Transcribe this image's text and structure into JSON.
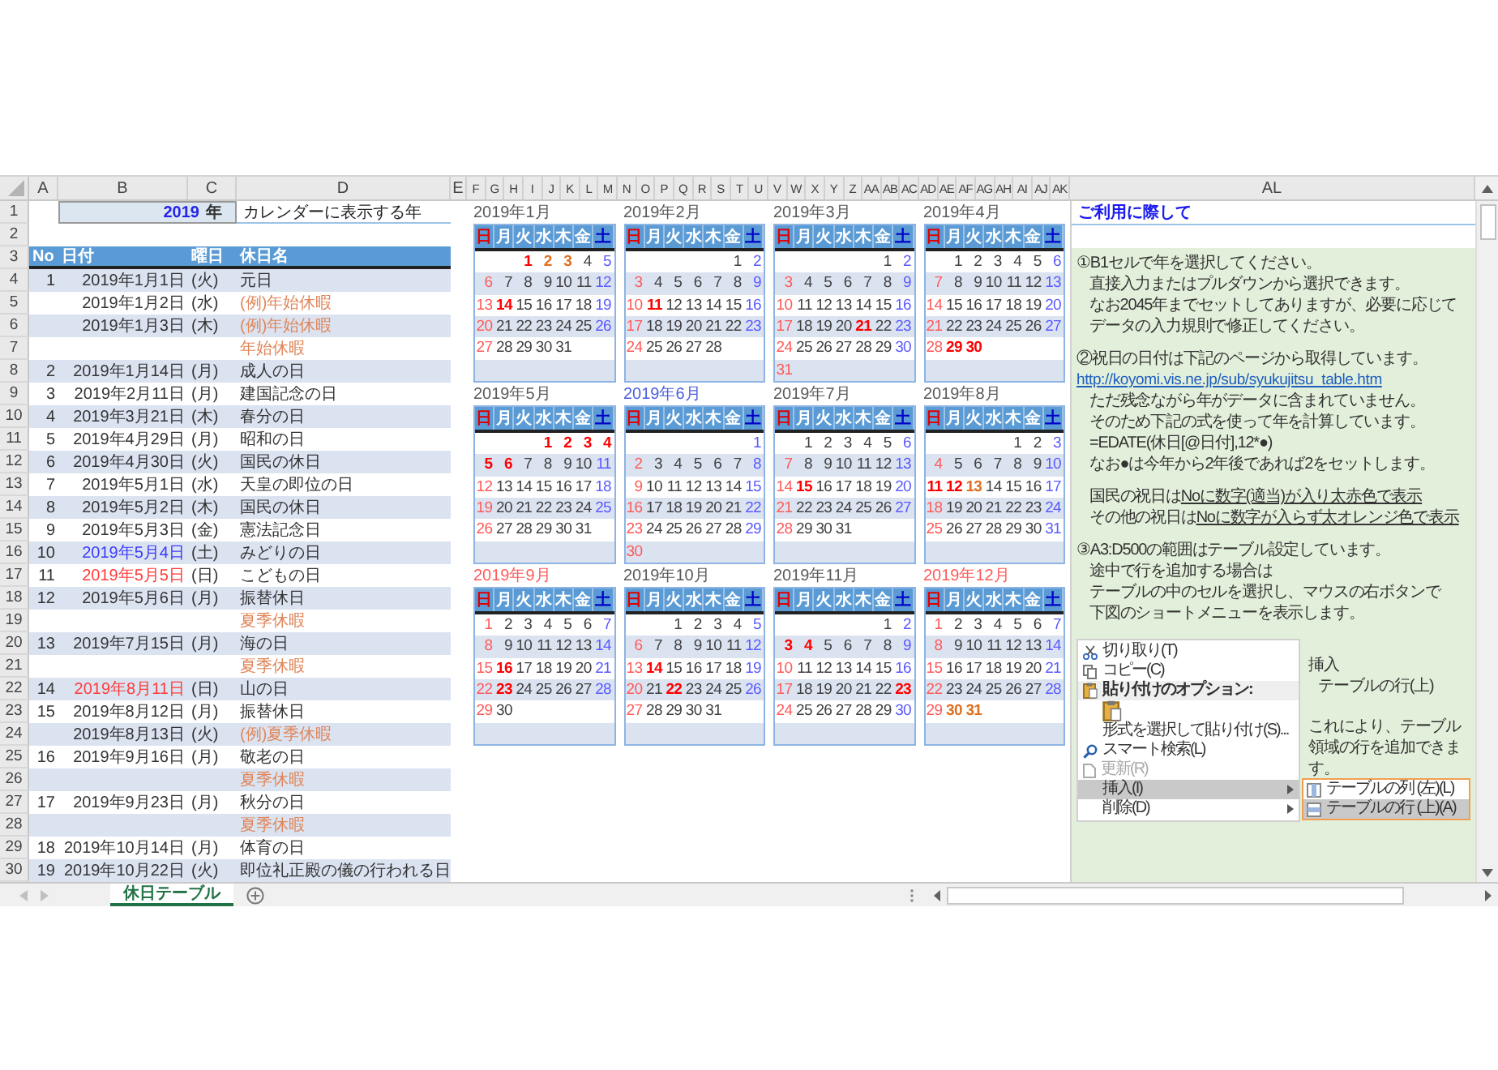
{
  "left_columns": [
    "A",
    "B",
    "C",
    "D",
    "E"
  ],
  "calendar_columns": [
    "F",
    "G",
    "H",
    "I",
    "J",
    "K",
    "L",
    "M",
    "N",
    "O",
    "P",
    "Q",
    "R",
    "S",
    "T",
    "U",
    "V",
    "W",
    "X",
    "Y",
    "Z",
    "AA",
    "AB",
    "AC",
    "AD",
    "AE",
    "AF",
    "AG",
    "AH",
    "AI",
    "AJ",
    "AK"
  ],
  "notes_column": "AL",
  "row_headers": [
    "1",
    "2",
    "3",
    "4",
    "5",
    "6",
    "7",
    "8",
    "9",
    "10",
    "11",
    "12",
    "13",
    "14",
    "15",
    "16",
    "17",
    "18",
    "19",
    "20",
    "21",
    "22",
    "23",
    "24",
    "25",
    "26",
    "27",
    "28",
    "29",
    "30"
  ],
  "year_cell": {
    "year": "2019",
    "unit": "年"
  },
  "year_caption": "カレンダーに表示する年",
  "table": {
    "columns": [
      "No",
      "日付",
      "曜日",
      "休日名"
    ],
    "rows": [
      {
        "no": "1",
        "date": {
          "text": "2019年1月1日",
          "color": "#333333"
        },
        "weekday": "(火)",
        "name": {
          "text": "元日",
          "color": "#333333"
        }
      },
      {
        "date": {
          "text": "2019年1月2日",
          "color": "#333333"
        },
        "weekday": "(水)",
        "name": {
          "text": "(例)年始休暇",
          "color": "#e0865a"
        }
      },
      {
        "date": {
          "text": "2019年1月3日",
          "color": "#333333"
        },
        "weekday": "(木)",
        "name": {
          "text": "(例)年始休暇",
          "color": "#e0865a"
        }
      },
      {
        "name": {
          "text": "年始休暇",
          "color": "#e0865a"
        }
      },
      {
        "no": "2",
        "date": {
          "text": "2019年1月14日",
          "color": "#333333"
        },
        "weekday": "(月)",
        "name": {
          "text": "成人の日",
          "color": "#333333"
        }
      },
      {
        "no": "3",
        "date": {
          "text": "2019年2月11日",
          "color": "#333333"
        },
        "weekday": "(月)",
        "name": {
          "text": "建国記念の日",
          "color": "#333333"
        }
      },
      {
        "no": "4",
        "date": {
          "text": "2019年3月21日",
          "color": "#333333"
        },
        "weekday": "(木)",
        "name": {
          "text": "春分の日",
          "color": "#333333"
        }
      },
      {
        "no": "5",
        "date": {
          "text": "2019年4月29日",
          "color": "#333333"
        },
        "weekday": "(月)",
        "name": {
          "text": "昭和の日",
          "color": "#333333"
        }
      },
      {
        "no": "6",
        "date": {
          "text": "2019年4月30日",
          "color": "#333333"
        },
        "weekday": "(火)",
        "name": {
          "text": "国民の休日",
          "color": "#333333"
        }
      },
      {
        "no": "7",
        "date": {
          "text": "2019年5月1日",
          "color": "#333333"
        },
        "weekday": "(水)",
        "name": {
          "text": "天皇の即位の日",
          "color": "#333333"
        }
      },
      {
        "no": "8",
        "date": {
          "text": "2019年5月2日",
          "color": "#333333"
        },
        "weekday": "(木)",
        "name": {
          "text": "国民の休日",
          "color": "#333333"
        }
      },
      {
        "no": "9",
        "date": {
          "text": "2019年5月3日",
          "color": "#333333"
        },
        "weekday": "(金)",
        "name": {
          "text": "憲法記念日",
          "color": "#333333"
        }
      },
      {
        "no": "10",
        "date": {
          "text": "2019年5月4日",
          "color": "#3a3aff"
        },
        "weekday": "(土)",
        "name": {
          "text": "みどりの日",
          "color": "#333333"
        }
      },
      {
        "no": "11",
        "date": {
          "text": "2019年5月5日",
          "color": "#ff3b3b"
        },
        "weekday": "(日)",
        "name": {
          "text": "こどもの日",
          "color": "#333333"
        }
      },
      {
        "no": "12",
        "date": {
          "text": "2019年5月6日",
          "color": "#333333"
        },
        "weekday": "(月)",
        "name": {
          "text": "振替休日",
          "color": "#333333"
        }
      },
      {
        "name": {
          "text": "夏季休暇",
          "color": "#e0865a"
        }
      },
      {
        "no": "13",
        "date": {
          "text": "2019年7月15日",
          "color": "#333333"
        },
        "weekday": "(月)",
        "name": {
          "text": "海の日",
          "color": "#333333"
        }
      },
      {
        "name": {
          "text": "夏季休暇",
          "color": "#e0865a"
        }
      },
      {
        "no": "14",
        "date": {
          "text": "2019年8月11日",
          "color": "#ff3b3b"
        },
        "weekday": "(日)",
        "name": {
          "text": "山の日",
          "color": "#333333"
        }
      },
      {
        "no": "15",
        "date": {
          "text": "2019年8月12日",
          "color": "#333333"
        },
        "weekday": "(月)",
        "name": {
          "text": "振替休日",
          "color": "#333333"
        }
      },
      {
        "date": {
          "text": "2019年8月13日",
          "color": "#333333"
        },
        "weekday": "(火)",
        "name": {
          "text": "(例)夏季休暇",
          "color": "#e0865a"
        }
      },
      {
        "no": "16",
        "date": {
          "text": "2019年9月16日",
          "color": "#333333"
        },
        "weekday": "(月)",
        "name": {
          "text": "敬老の日",
          "color": "#333333"
        }
      },
      {
        "name": {
          "text": "夏季休暇",
          "color": "#e0865a"
        }
      },
      {
        "no": "17",
        "date": {
          "text": "2019年9月23日",
          "color": "#333333"
        },
        "weekday": "(月)",
        "name": {
          "text": "秋分の日",
          "color": "#333333"
        }
      },
      {
        "name": {
          "text": "夏季休暇",
          "color": "#e0865a"
        }
      },
      {
        "no": "18",
        "date": {
          "text": "2019年10月14日",
          "color": "#333333"
        },
        "weekday": "(月)",
        "name": {
          "text": "体育の日",
          "color": "#333333"
        }
      },
      {
        "no": "19",
        "date": {
          "text": "2019年10月22日",
          "color": "#333333"
        },
        "weekday": "(火)",
        "name": {
          "text": "即位礼正殿の儀の行われる日",
          "color": "#333333"
        }
      }
    ]
  },
  "calendars": [
    {
      "title": "2019年1月",
      "color": "#595959",
      "weekdays": [
        "日",
        "月",
        "火",
        "水",
        "木",
        "金",
        "土"
      ],
      "weeks": [
        [
          {
            "day": "1",
            "color": "#ff0000"
          },
          {
            "day": "2",
            "color": "#e07020"
          },
          {
            "day": "3",
            "color": "#e07020"
          },
          "4",
          "5"
        ],
        [
          "6",
          "7",
          "8",
          "9",
          "10",
          "11",
          "12"
        ],
        [
          "13",
          {
            "day": "14",
            "color": "#ff0000"
          },
          "15",
          "16",
          "17",
          "18",
          "19"
        ],
        [
          "20",
          "21",
          "22",
          "23",
          "24",
          "25",
          "26"
        ],
        [
          "27",
          "28",
          "29",
          "30",
          "31"
        ]
      ]
    },
    {
      "title": "2019年2月",
      "color": "#595959",
      "weekdays": [
        "日",
        "月",
        "火",
        "水",
        "木",
        "金",
        "土"
      ],
      "weeks": [
        [
          "1",
          "2"
        ],
        [
          "3",
          "4",
          "5",
          "6",
          "7",
          "8",
          "9"
        ],
        [
          "10",
          {
            "day": "11",
            "color": "#ff0000"
          },
          "12",
          "13",
          "14",
          "15",
          "16"
        ],
        [
          "17",
          "18",
          "19",
          "20",
          "21",
          "22",
          "23"
        ],
        [
          "24",
          "25",
          "26",
          "27",
          "28"
        ]
      ]
    },
    {
      "title": "2019年3月",
      "color": "#595959",
      "weekdays": [
        "日",
        "月",
        "火",
        "水",
        "木",
        "金",
        "土"
      ],
      "weeks": [
        [
          "1",
          "2"
        ],
        [
          "3",
          "4",
          "5",
          "6",
          "7",
          "8",
          "9"
        ],
        [
          "10",
          "11",
          "12",
          "13",
          "14",
          "15",
          "16"
        ],
        [
          "17",
          "18",
          "19",
          "20",
          {
            "day": "21",
            "color": "#ff0000"
          },
          "22",
          "23"
        ],
        [
          "24",
          "25",
          "26",
          "27",
          "28",
          "29",
          "30"
        ],
        [
          "31"
        ]
      ]
    },
    {
      "title": "2019年4月",
      "color": "#595959",
      "weekdays": [
        "日",
        "月",
        "火",
        "水",
        "木",
        "金",
        "土"
      ],
      "weeks": [
        [
          "1",
          "2",
          "3",
          "4",
          "5",
          "6"
        ],
        [
          "7",
          "8",
          "9",
          "10",
          "11",
          "12",
          "13"
        ],
        [
          "14",
          "15",
          "16",
          "17",
          "18",
          "19",
          "20"
        ],
        [
          "21",
          "22",
          "23",
          "24",
          "25",
          "26",
          "27"
        ],
        [
          "28",
          {
            "day": "29",
            "color": "#ff0000"
          },
          {
            "day": "30",
            "color": "#ff0000"
          }
        ]
      ]
    },
    {
      "title": "2019年5月",
      "color": "#595959",
      "weekdays": [
        "日",
        "月",
        "火",
        "水",
        "木",
        "金",
        "土"
      ],
      "weeks": [
        [
          {
            "day": "1",
            "color": "#ff0000"
          },
          {
            "day": "2",
            "color": "#ff0000"
          },
          {
            "day": "3",
            "color": "#ff0000"
          },
          {
            "day": "4",
            "color": "#ff0000"
          }
        ],
        [
          {
            "day": "5",
            "color": "#ff0000"
          },
          {
            "day": "6",
            "color": "#ff0000"
          },
          "7",
          "8",
          "9",
          "10",
          "11"
        ],
        [
          "12",
          "13",
          "14",
          "15",
          "16",
          "17",
          "18"
        ],
        [
          "19",
          "20",
          "21",
          "22",
          "23",
          "24",
          "25"
        ],
        [
          "26",
          "27",
          "28",
          "29",
          "30",
          "31"
        ]
      ]
    },
    {
      "title": "2019年6月",
      "color": "#4a5ee0",
      "weekdays": [
        "日",
        "月",
        "火",
        "水",
        "木",
        "金",
        "土"
      ],
      "weeks": [
        [
          "1"
        ],
        [
          "2",
          "3",
          "4",
          "5",
          "6",
          "7",
          "8"
        ],
        [
          "9",
          "10",
          "11",
          "12",
          "13",
          "14",
          "15"
        ],
        [
          "16",
          "17",
          "18",
          "19",
          "20",
          "21",
          "22"
        ],
        [
          "23",
          "24",
          "25",
          "26",
          "27",
          "28",
          "29"
        ],
        [
          "30"
        ]
      ]
    },
    {
      "title": "2019年7月",
      "color": "#595959",
      "weekdays": [
        "日",
        "月",
        "火",
        "水",
        "木",
        "金",
        "土"
      ],
      "weeks": [
        [
          "1",
          "2",
          "3",
          "4",
          "5",
          "6"
        ],
        [
          "7",
          "8",
          "9",
          "10",
          "11",
          "12",
          "13"
        ],
        [
          "14",
          {
            "day": "15",
            "color": "#ff0000"
          },
          "16",
          "17",
          "18",
          "19",
          "20"
        ],
        [
          "21",
          "22",
          "23",
          "24",
          "25",
          "26",
          "27"
        ],
        [
          "28",
          "29",
          "30",
          "31"
        ]
      ]
    },
    {
      "title": "2019年8月",
      "color": "#595959",
      "weekdays": [
        "日",
        "月",
        "火",
        "水",
        "木",
        "金",
        "土"
      ],
      "weeks": [
        [
          "1",
          "2",
          "3"
        ],
        [
          "4",
          "5",
          "6",
          "7",
          "8",
          "9",
          "10"
        ],
        [
          {
            "day": "11",
            "color": "#ff0000"
          },
          {
            "day": "12",
            "color": "#ff0000"
          },
          {
            "day": "13",
            "color": "#e07020"
          },
          "14",
          "15",
          "16",
          "17"
        ],
        [
          "18",
          "19",
          "20",
          "21",
          "22",
          "23",
          "24"
        ],
        [
          "25",
          "26",
          "27",
          "28",
          "29",
          "30",
          "31"
        ]
      ]
    },
    {
      "title": "2019年9月",
      "color": "#ff5a5a",
      "weekdays": [
        "日",
        "月",
        "火",
        "水",
        "木",
        "金",
        "土"
      ],
      "weeks": [
        [
          "1",
          "2",
          "3",
          "4",
          "5",
          "6",
          "7"
        ],
        [
          "8",
          "9",
          "10",
          "11",
          "12",
          "13",
          "14"
        ],
        [
          "15",
          {
            "day": "16",
            "color": "#ff0000"
          },
          "17",
          "18",
          "19",
          "20",
          "21"
        ],
        [
          "22",
          {
            "day": "23",
            "color": "#ff0000"
          },
          "24",
          "25",
          "26",
          "27",
          "28"
        ],
        [
          "29",
          "30"
        ]
      ]
    },
    {
      "title": "2019年10月",
      "color": "#595959",
      "weekdays": [
        "日",
        "月",
        "火",
        "水",
        "木",
        "金",
        "土"
      ],
      "weeks": [
        [
          "1",
          "2",
          "3",
          "4",
          "5"
        ],
        [
          "6",
          "7",
          "8",
          "9",
          "10",
          "11",
          "12"
        ],
        [
          "13",
          {
            "day": "14",
            "color": "#ff0000"
          },
          "15",
          "16",
          "17",
          "18",
          "19"
        ],
        [
          "20",
          "21",
          {
            "day": "22",
            "color": "#ff0000"
          },
          "23",
          "24",
          "25",
          "26"
        ],
        [
          "27",
          "28",
          "29",
          "30",
          "31"
        ]
      ]
    },
    {
      "title": "2019年11月",
      "color": "#595959",
      "weekdays": [
        "日",
        "月",
        "火",
        "水",
        "木",
        "金",
        "土"
      ],
      "weeks": [
        [
          "1",
          "2"
        ],
        [
          {
            "day": "3",
            "color": "#ff0000"
          },
          {
            "day": "4",
            "color": "#ff0000"
          },
          "5",
          "6",
          "7",
          "8",
          "9"
        ],
        [
          "10",
          "11",
          "12",
          "13",
          "14",
          "15",
          "16"
        ],
        [
          "17",
          "18",
          "19",
          "20",
          "21",
          "22",
          {
            "day": "23",
            "color": "#ff0000"
          }
        ],
        [
          "24",
          "25",
          "26",
          "27",
          "28",
          "29",
          "30"
        ]
      ]
    },
    {
      "title": "2019年12月",
      "color": "#ff5a5a",
      "weekdays": [
        "日",
        "月",
        "火",
        "水",
        "木",
        "金",
        "土"
      ],
      "weeks": [
        [
          "1",
          "2",
          "3",
          "4",
          "5",
          "6",
          "7"
        ],
        [
          "8",
          "9",
          "10",
          "11",
          "12",
          "13",
          "14"
        ],
        [
          "15",
          "16",
          "17",
          "18",
          "19",
          "20",
          "21"
        ],
        [
          "22",
          "23",
          "24",
          "25",
          "26",
          "27",
          "28"
        ],
        [
          "29",
          {
            "day": "30",
            "color": "#e07020"
          },
          {
            "day": "31",
            "color": "#e07020"
          }
        ]
      ]
    }
  ],
  "notes": {
    "title": "ご利用に際して",
    "sections": [
      {
        "heading": "①B1セルで年を選択してください。",
        "items": [
          {
            "kind": "text",
            "text": "直接入力またはプルダウンから選択できます。"
          },
          {
            "kind": "text",
            "text": "なお2045年までセットしてありますが、必要に応じて"
          },
          {
            "kind": "text",
            "text": "データの入力規則で修正してください。"
          }
        ]
      },
      {
        "heading": "②祝日の日付は下記のページから取得しています。",
        "items": [
          {
            "kind": "link",
            "text": "http://koyomi.vis.ne.jp/sub/syukujitsu_table.htm"
          },
          {
            "kind": "text",
            "text": "ただ残念ながら年がデータに含まれていません。"
          },
          {
            "kind": "text",
            "text": "そのため下記の式を使って年を計算しています。"
          },
          {
            "kind": "text",
            "text": "=EDATE(休日[@日付],12*●)"
          },
          {
            "kind": "text",
            "text": "なお●は今年から2年後であれば2をセットします。"
          }
        ]
      },
      {
        "items": [
          {
            "kind": "underlined",
            "text": "国民の祝日は",
            "underlined": "Noに数字(適当)が入り太赤色で表示"
          },
          {
            "kind": "underlined",
            "text": "その他の祝日は",
            "underlined": "Noに数字が入らず太オレンジ色で表示"
          }
        ]
      },
      {
        "heading": "③A3:D500の範囲はテーブル設定しています。",
        "items": [
          {
            "kind": "text",
            "text": "途中で行を追加する場合は"
          },
          {
            "kind": "text",
            "text": "テーブルの中のセルを選択し、マウスの右ボタンで"
          },
          {
            "kind": "text",
            "text": "下図のショートメニューを表示します。"
          }
        ]
      }
    ],
    "context_menu": {
      "items": [
        {
          "kind": "cut",
          "label": "切り取り(T)",
          "selected": false,
          "disabled": false,
          "submenu_arrow": false
        },
        {
          "kind": "copy",
          "label": "コピー(C)",
          "selected": false,
          "disabled": false,
          "submenu_arrow": false
        },
        {
          "kind": "paste_heading",
          "label": "貼り付けのオプション:",
          "selected": false,
          "disabled": false,
          "submenu_arrow": false
        },
        {
          "kind": "paste_button",
          "selected": false,
          "disabled": false,
          "submenu_arrow": false
        },
        {
          "kind": "paste_special",
          "label": "形式を選択して貼り付け(S)...",
          "selected": false,
          "disabled": false,
          "submenu_arrow": false
        },
        {
          "kind": "lookup",
          "label": "スマート検索(L)",
          "selected": false,
          "disabled": false,
          "submenu_arrow": false
        },
        {
          "kind": "refresh",
          "label": "更新(R)",
          "selected": false,
          "disabled": true,
          "submenu_arrow": false
        },
        {
          "kind": "insert",
          "label": "挿入(I)",
          "selected": true,
          "disabled": false,
          "submenu_arrow": true,
          "submenu": [
            {
              "kind": "column",
              "label": "テーブルの列 (左)(L)",
              "selected": false
            },
            {
              "kind": "row",
              "label": "テーブルの行 (上)(A)",
              "selected": true
            }
          ]
        },
        {
          "kind": "delete",
          "label": "削除(D)",
          "selected": false,
          "disabled": false,
          "submenu_arrow": true
        }
      ]
    },
    "menu_command": "挿入",
    "menu_option": "テーブルの行(上)",
    "result_note": "これにより、テーブル領域の行を追加できます。"
  },
  "sheet_tabs": [
    {
      "label": "休日テーブル",
      "selected": true
    }
  ]
}
